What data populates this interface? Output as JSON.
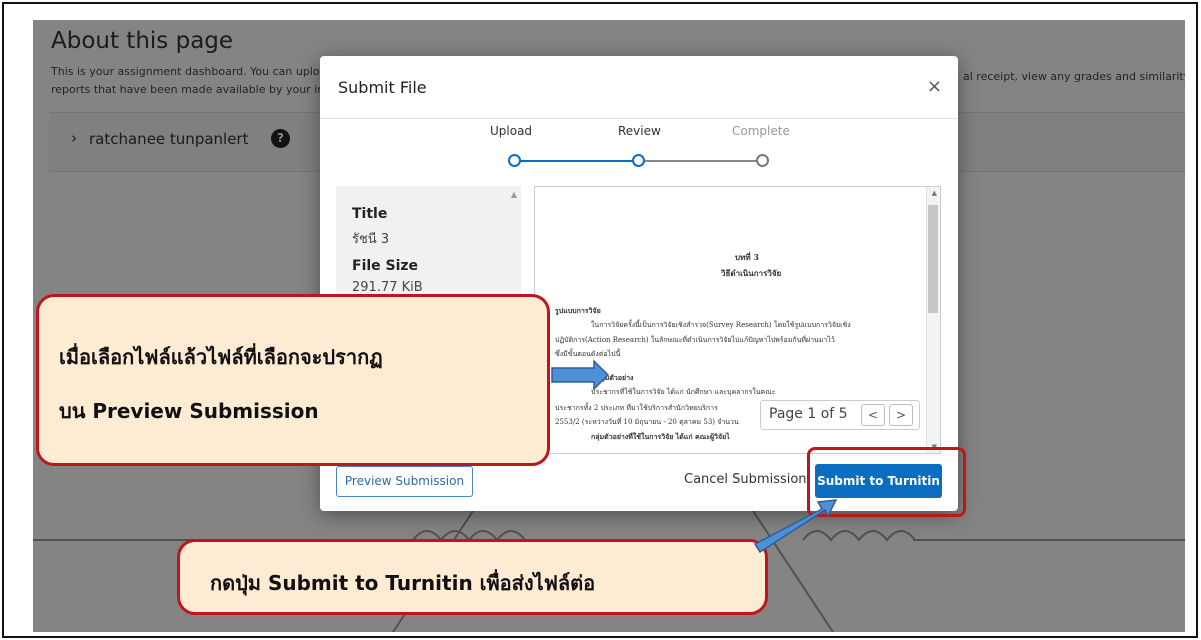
{
  "background": {
    "heading": "About this page",
    "description_line1": "This is your assignment dashboard. You can upload",
    "description_line2": "reports that have been made available by your instr",
    "description_right": "al receipt, view any grades and similarity",
    "user_name": "ratchanee tunpanlert",
    "help_icon": "?"
  },
  "modal": {
    "title": "Submit File",
    "close_icon": "×",
    "steps": [
      {
        "label": "Upload",
        "state": "done"
      },
      {
        "label": "Review",
        "state": "current"
      },
      {
        "label": "Complete",
        "state": "pending"
      }
    ],
    "meta": {
      "title_label": "Title",
      "title_value": "รัชนี 3",
      "size_label": "File Size",
      "size_value": "291.77 KiB"
    },
    "document": {
      "heading1": "บทที่ 3",
      "heading2": "วิธีดำเนินการวิจัย",
      "lines": [
        "รูปแบบการวิจัย",
        "ในการวิจัยครั้งนี้เป็นการวิจัยเชิงสำรวจ(Survey Research) โดยใช้รูปแบบการวิจัยเชิง",
        "ปฏิบัติการ(Action Research) ในลักษณะที่ดำเนินการวิจัยไปแก้ปัญหาไปพร้อมกันที่ผ่านมาไว้",
        "ซึ่งมีขั้นตอนดังต่อไปนี้",
        "ประชากรและกลุ่มตัวอย่าง",
        "ประชากรที่ใช้ในการวิจัย ได้แก่ นักศึกษา และบุคลากรในคณะ",
        "ประชากรทั้ง 2 ประเภท ที่มาใช้บริการสำนักวิทยบริการ",
        "2553/2 (ระหว่างวันที่ 10 มิถุนายน - 20 ตุลาคม 53) จำนวน",
        "กลุ่มตัวอย่างที่ใช้ในการวิจัย ได้แก่ คณะผู้วิจัยไ"
      ]
    },
    "pager": {
      "text": "Page 1 of 5",
      "prev_label": "<",
      "next_label": ">"
    },
    "preview_button": "Preview Submission",
    "cancel_button": "Cancel Submission",
    "submit_button": "Submit to Turnitin"
  },
  "callouts": {
    "preview_note_line1": "เมื่อเลือกไฟล์แล้วไฟล์ที่เลือกจะปรากฏ",
    "preview_note_line2": "บน Preview Submission",
    "submit_note": "กดปุ่ม Submit to Turnitin เพื่อส่งไฟล์ต่อ"
  },
  "colors": {
    "accent": "#0a6dbf",
    "callout_fill": "#fdebd3",
    "callout_border": "#c0161b",
    "arrow": "#4f8fd6"
  }
}
